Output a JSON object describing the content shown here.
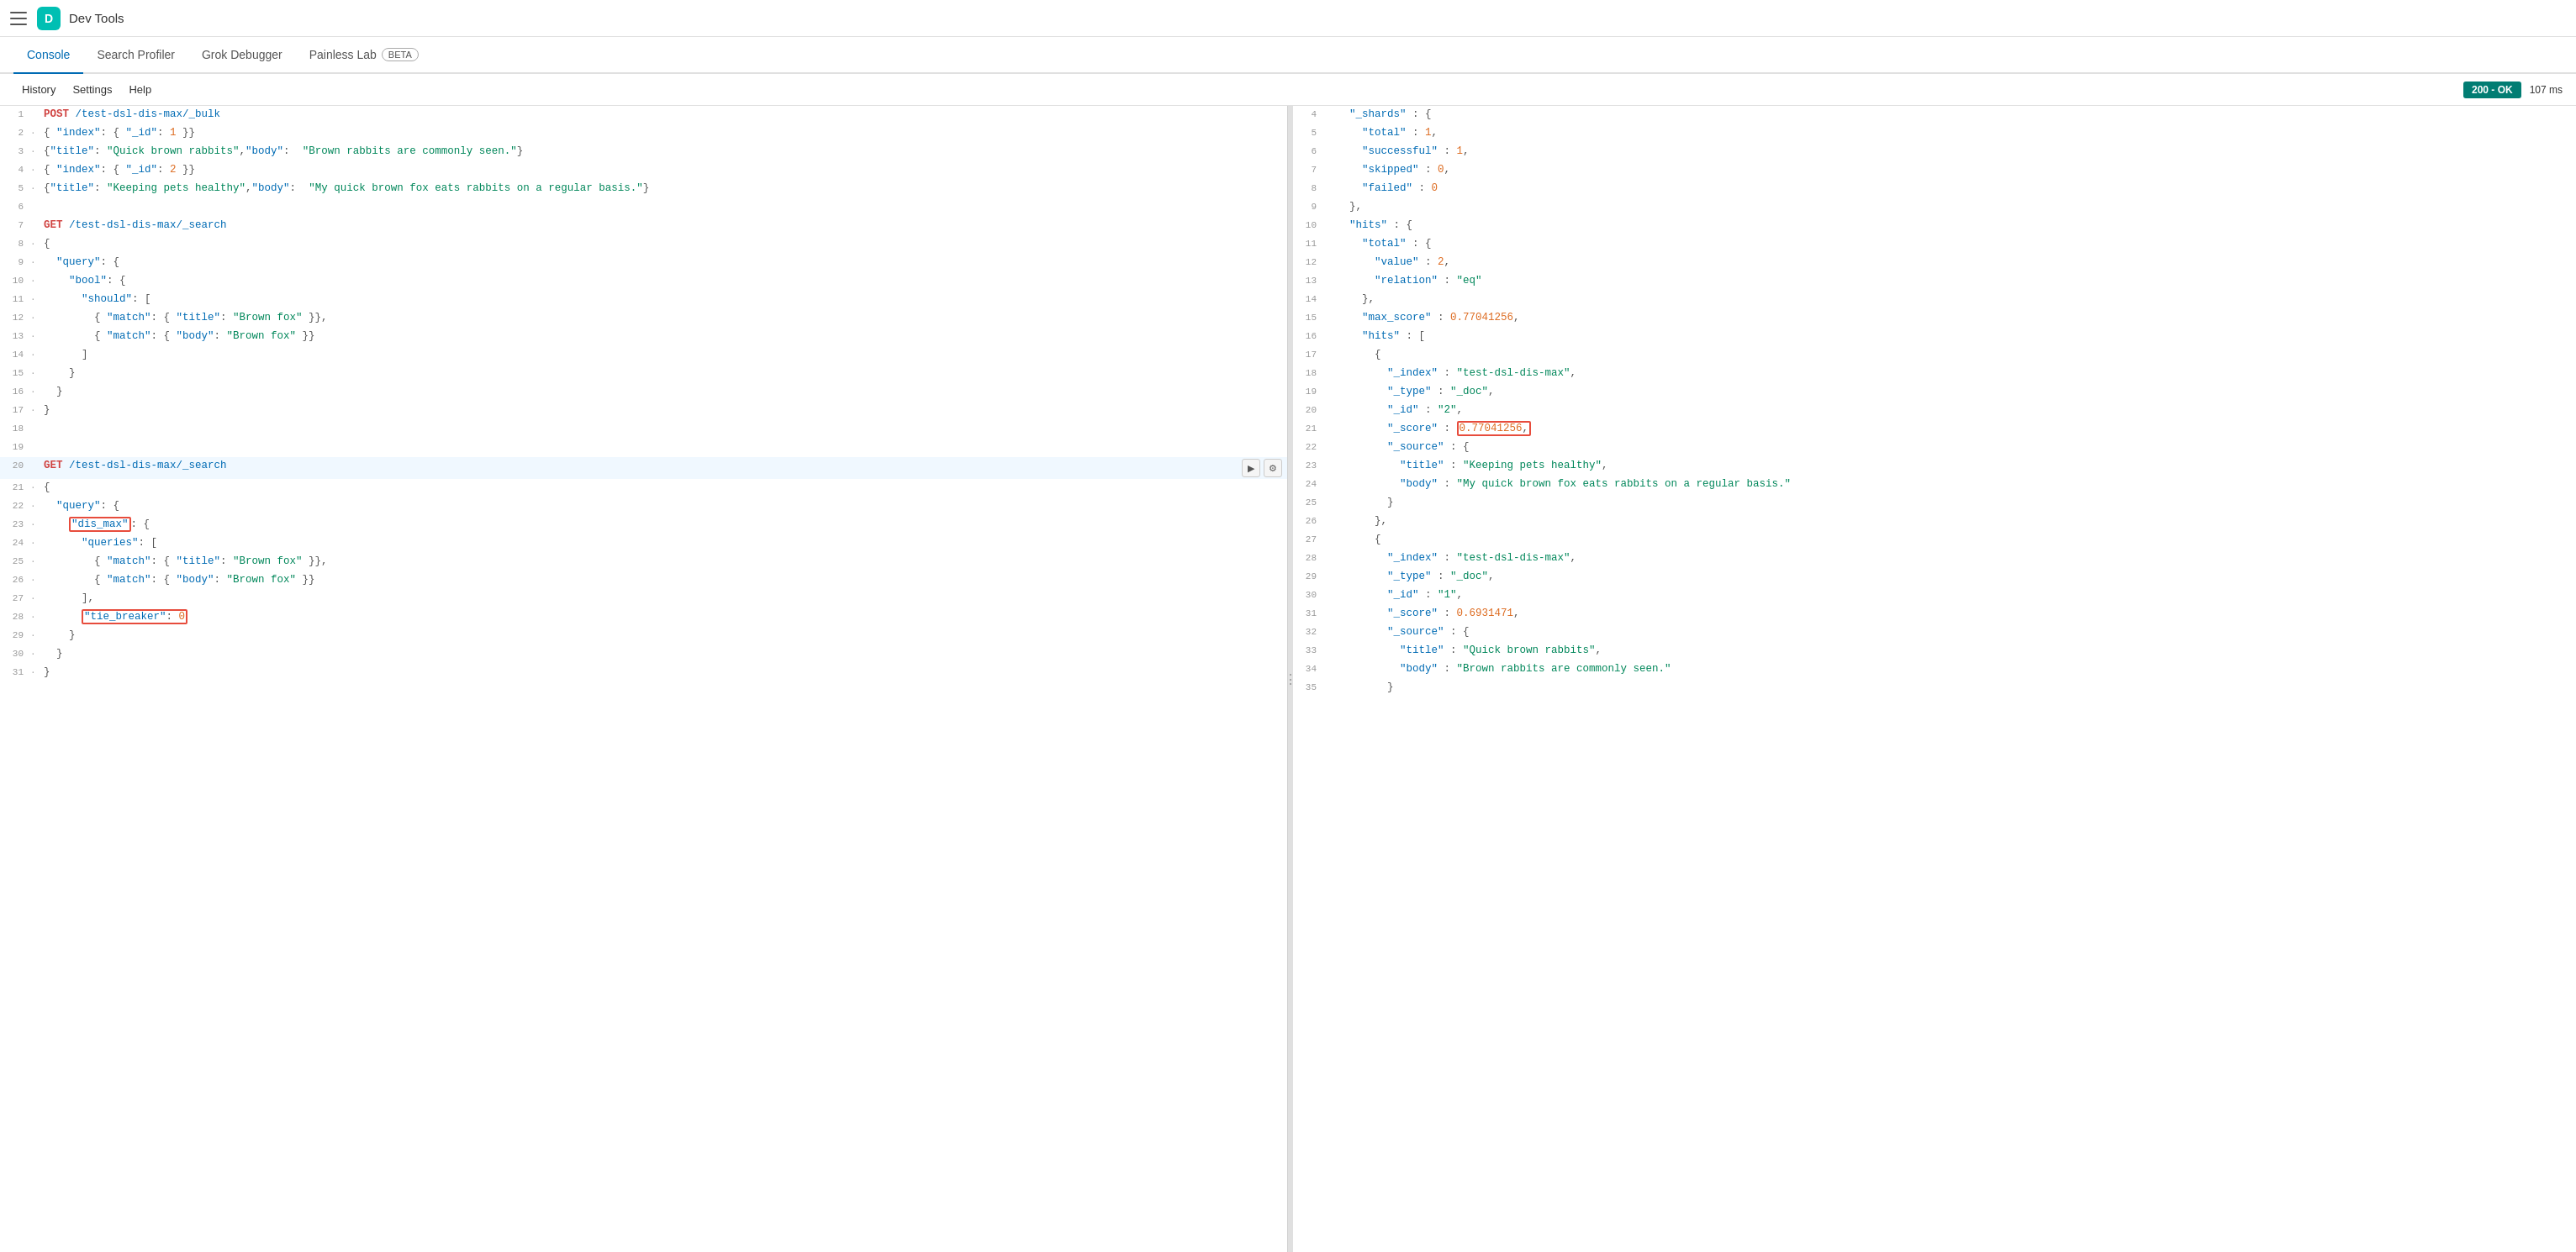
{
  "topbar": {
    "logo": "D",
    "title": "Dev Tools"
  },
  "nav": {
    "tabs": [
      {
        "id": "console",
        "label": "Console",
        "active": true
      },
      {
        "id": "search-profiler",
        "label": "Search Profiler",
        "active": false
      },
      {
        "id": "grok-debugger",
        "label": "Grok Debugger",
        "active": false
      },
      {
        "id": "painless-lab",
        "label": "Painless Lab",
        "active": false,
        "badge": "BETA"
      }
    ]
  },
  "toolbar": {
    "history": "History",
    "settings": "Settings",
    "help": "Help",
    "status": "200 - OK",
    "response_time": "107 ms"
  },
  "editor": {
    "lines": [
      {
        "num": 1,
        "indent": "",
        "content": "POST /test-dsl-dis-max/_bulk",
        "type": "method-path"
      },
      {
        "num": 2,
        "indent": "·",
        "content": "{ \"index\": { \"_id\": 1 }}",
        "type": "code"
      },
      {
        "num": 3,
        "indent": "·",
        "content": "{\"title\": \"Quick brown rabbits\",\"body\":  \"Brown rabbits are commonly seen.\"}",
        "type": "code"
      },
      {
        "num": 4,
        "indent": "·",
        "content": "{ \"index\": { \"_id\": 2 }}",
        "type": "code"
      },
      {
        "num": 5,
        "indent": "·",
        "content": "{\"title\": \"Keeping pets healthy\",\"body\":  \"My quick brown fox eats rabbits on a regular basis.\"}",
        "type": "code"
      },
      {
        "num": 6,
        "indent": "",
        "content": "",
        "type": "empty"
      },
      {
        "num": 7,
        "indent": "",
        "content": "GET /test-dsl-dis-max/_search",
        "type": "method-path"
      },
      {
        "num": 8,
        "indent": "·",
        "content": "{",
        "type": "code"
      },
      {
        "num": 9,
        "indent": "·",
        "content": "  \"query\": {",
        "type": "code"
      },
      {
        "num": 10,
        "indent": "·",
        "content": "    \"bool\": {",
        "type": "code"
      },
      {
        "num": 11,
        "indent": "·",
        "content": "      \"should\": [",
        "type": "code"
      },
      {
        "num": 12,
        "indent": "·",
        "content": "        { \"match\": { \"title\": \"Brown fox\" }},",
        "type": "code"
      },
      {
        "num": 13,
        "indent": "·",
        "content": "        { \"match\": { \"body\": \"Brown fox\" }}",
        "type": "code"
      },
      {
        "num": 14,
        "indent": "·",
        "content": "      ]",
        "type": "code"
      },
      {
        "num": 15,
        "indent": "·",
        "content": "    }",
        "type": "code"
      },
      {
        "num": 16,
        "indent": "·",
        "content": "  }",
        "type": "code"
      },
      {
        "num": 17,
        "indent": "·",
        "content": "}",
        "type": "code"
      },
      {
        "num": 18,
        "indent": "",
        "content": "",
        "type": "empty"
      },
      {
        "num": 19,
        "indent": "",
        "content": "",
        "type": "empty"
      },
      {
        "num": 20,
        "indent": "",
        "content": "GET /test-dsl-dis-max/_search",
        "type": "method-path",
        "hasActions": true
      },
      {
        "num": 21,
        "indent": "·",
        "content": "{",
        "type": "code"
      },
      {
        "num": 22,
        "indent": "·",
        "content": "  \"query\": {",
        "type": "code"
      },
      {
        "num": 23,
        "indent": "·",
        "content": "    \"dis_max\": {",
        "type": "code",
        "highlight": "dis_max"
      },
      {
        "num": 24,
        "indent": "·",
        "content": "      \"queries\": [",
        "type": "code"
      },
      {
        "num": 25,
        "indent": "·",
        "content": "        { \"match\": { \"title\": \"Brown fox\" }},",
        "type": "code"
      },
      {
        "num": 26,
        "indent": "·",
        "content": "        { \"match\": { \"body\": \"Brown fox\" }}",
        "type": "code"
      },
      {
        "num": 27,
        "indent": "·",
        "content": "      ],",
        "type": "code"
      },
      {
        "num": 28,
        "indent": "·",
        "content": "      \"tie_breaker\": 0",
        "type": "code",
        "highlight": "tie_breaker_line"
      },
      {
        "num": 29,
        "indent": "·",
        "content": "    }",
        "type": "code"
      },
      {
        "num": 30,
        "indent": "·",
        "content": "  }",
        "type": "code"
      },
      {
        "num": 31,
        "indent": "·",
        "content": "}",
        "type": "code"
      }
    ]
  },
  "response": {
    "lines": [
      {
        "num": 4,
        "content": "\"_shards\" : {"
      },
      {
        "num": 5,
        "content": "  \"total\" : 1,"
      },
      {
        "num": 6,
        "content": "  \"successful\" : 1,"
      },
      {
        "num": 7,
        "content": "  \"skipped\" : 0,"
      },
      {
        "num": 8,
        "content": "  \"failed\" : 0"
      },
      {
        "num": 9,
        "content": "},"
      },
      {
        "num": 10,
        "content": "\"hits\" : {"
      },
      {
        "num": 11,
        "content": "  \"total\" : {"
      },
      {
        "num": 12,
        "content": "    \"value\" : 2,"
      },
      {
        "num": 13,
        "content": "    \"relation\" : \"eq\""
      },
      {
        "num": 14,
        "content": "  },"
      },
      {
        "num": 15,
        "content": "  \"max_score\" : 0.77041256,"
      },
      {
        "num": 16,
        "content": "  \"hits\" : ["
      },
      {
        "num": 17,
        "content": "    {"
      },
      {
        "num": 18,
        "content": "      \"_index\" : \"test-dsl-dis-max\","
      },
      {
        "num": 19,
        "content": "      \"_type\" : \"_doc\","
      },
      {
        "num": 20,
        "content": "      \"_id\" : \"2\","
      },
      {
        "num": 21,
        "content": "      \"_score\" : 0.77041256,",
        "highlight": true
      },
      {
        "num": 22,
        "content": "      \"_source\" : {"
      },
      {
        "num": 23,
        "content": "        \"title\" : \"Keeping pets healthy\","
      },
      {
        "num": 24,
        "content": "        \"body\" : \"My quick brown fox eats rabbits on a regular basis.\""
      },
      {
        "num": 25,
        "content": "      }"
      },
      {
        "num": 26,
        "content": "    },"
      },
      {
        "num": 27,
        "content": "    {"
      },
      {
        "num": 28,
        "content": "      \"_index\" : \"test-dsl-dis-max\","
      },
      {
        "num": 29,
        "content": "      \"_type\" : \"_doc\","
      },
      {
        "num": 30,
        "content": "      \"_id\" : \"1\","
      },
      {
        "num": 31,
        "content": "      \"_score\" : 0.6931471,"
      },
      {
        "num": 32,
        "content": "      \"_source\" : {"
      },
      {
        "num": 33,
        "content": "        \"title\" : \"Quick brown rabbits\","
      },
      {
        "num": 34,
        "content": "        \"body\" : \"Brown rabbits are commonly seen.\""
      },
      {
        "num": 35,
        "content": "      }"
      }
    ]
  },
  "icons": {
    "play": "▶",
    "wrench": "🔧",
    "hamburger": "☰",
    "resize": "⋮"
  }
}
